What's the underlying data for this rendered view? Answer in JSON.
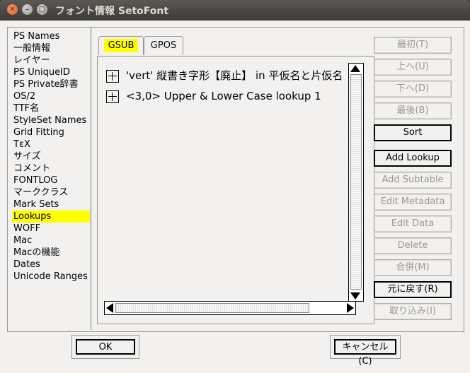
{
  "window": {
    "title": "フォント情報 SetoFont",
    "close_glyph": "✕",
    "min_glyph": "–",
    "max_glyph": "□"
  },
  "sidebar": {
    "items": [
      {
        "label": "PS Names"
      },
      {
        "label": "一般情報"
      },
      {
        "label": "レイヤー"
      },
      {
        "label": "PS UniqueID"
      },
      {
        "label": "PS Private辞書"
      },
      {
        "label": "OS/2"
      },
      {
        "label": "TTF名"
      },
      {
        "label": "StyleSet Names"
      },
      {
        "label": "Grid Fitting"
      },
      {
        "label": "TεX"
      },
      {
        "label": "サイズ"
      },
      {
        "label": "コメント"
      },
      {
        "label": "FONTLOG"
      },
      {
        "label": "マーククラス"
      },
      {
        "label": "Mark Sets"
      },
      {
        "label": "Lookups",
        "selected": true
      },
      {
        "label": "WOFF"
      },
      {
        "label": "Mac"
      },
      {
        "label": "Macの機能"
      },
      {
        "label": "Dates"
      },
      {
        "label": "Unicode Ranges"
      }
    ]
  },
  "tabs": [
    {
      "label": "GSUB",
      "active": true
    },
    {
      "label": "GPOS",
      "active": false
    }
  ],
  "lookups": [
    {
      "label": "'vert' 縦書き字形【廃止】 in 平仮名と片仮名"
    },
    {
      "label": "<3,0> Upper & Lower Case lookup 1"
    }
  ],
  "buttons": [
    {
      "label": "最初(T)",
      "enabled": false
    },
    {
      "label": "上へ(U)",
      "enabled": false
    },
    {
      "label": "下へ(D)",
      "enabled": false
    },
    {
      "label": "最後(B)",
      "enabled": false
    },
    {
      "label": "Sort",
      "enabled": true
    },
    {
      "label": "Add Lookup",
      "enabled": true
    },
    {
      "label": "Add Subtable",
      "enabled": false
    },
    {
      "label": "Edit Metadata",
      "enabled": false
    },
    {
      "label": "Edit Data",
      "enabled": false
    },
    {
      "label": "Delete",
      "enabled": false
    },
    {
      "label": "合併(M)",
      "enabled": false
    },
    {
      "label": "元に戻す(R)",
      "enabled": true
    },
    {
      "label": "取り込み(I)",
      "enabled": false
    }
  ],
  "footer": {
    "ok_label": "OK",
    "cancel_label": "キャンセル(C)"
  },
  "colors": {
    "highlight": "#ffff00",
    "titlebar": "#3c3b37",
    "close_button": "#e05a23"
  }
}
